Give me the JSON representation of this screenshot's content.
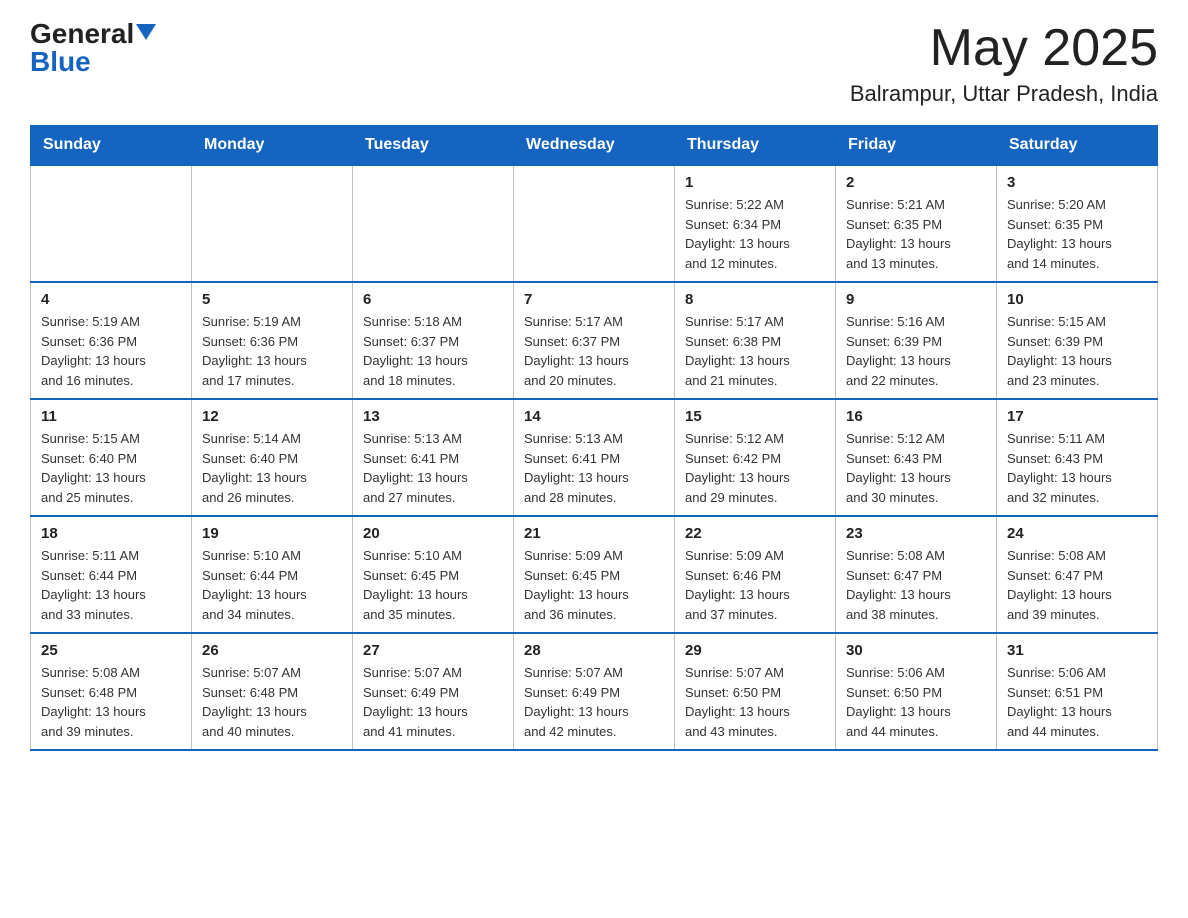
{
  "header": {
    "logo_general": "General",
    "logo_blue": "Blue",
    "month_year": "May 2025",
    "location": "Balrampur, Uttar Pradesh, India"
  },
  "days_of_week": [
    "Sunday",
    "Monday",
    "Tuesday",
    "Wednesday",
    "Thursday",
    "Friday",
    "Saturday"
  ],
  "weeks": [
    [
      {
        "day": "",
        "info": ""
      },
      {
        "day": "",
        "info": ""
      },
      {
        "day": "",
        "info": ""
      },
      {
        "day": "",
        "info": ""
      },
      {
        "day": "1",
        "info": "Sunrise: 5:22 AM\nSunset: 6:34 PM\nDaylight: 13 hours\nand 12 minutes."
      },
      {
        "day": "2",
        "info": "Sunrise: 5:21 AM\nSunset: 6:35 PM\nDaylight: 13 hours\nand 13 minutes."
      },
      {
        "day": "3",
        "info": "Sunrise: 5:20 AM\nSunset: 6:35 PM\nDaylight: 13 hours\nand 14 minutes."
      }
    ],
    [
      {
        "day": "4",
        "info": "Sunrise: 5:19 AM\nSunset: 6:36 PM\nDaylight: 13 hours\nand 16 minutes."
      },
      {
        "day": "5",
        "info": "Sunrise: 5:19 AM\nSunset: 6:36 PM\nDaylight: 13 hours\nand 17 minutes."
      },
      {
        "day": "6",
        "info": "Sunrise: 5:18 AM\nSunset: 6:37 PM\nDaylight: 13 hours\nand 18 minutes."
      },
      {
        "day": "7",
        "info": "Sunrise: 5:17 AM\nSunset: 6:37 PM\nDaylight: 13 hours\nand 20 minutes."
      },
      {
        "day": "8",
        "info": "Sunrise: 5:17 AM\nSunset: 6:38 PM\nDaylight: 13 hours\nand 21 minutes."
      },
      {
        "day": "9",
        "info": "Sunrise: 5:16 AM\nSunset: 6:39 PM\nDaylight: 13 hours\nand 22 minutes."
      },
      {
        "day": "10",
        "info": "Sunrise: 5:15 AM\nSunset: 6:39 PM\nDaylight: 13 hours\nand 23 minutes."
      }
    ],
    [
      {
        "day": "11",
        "info": "Sunrise: 5:15 AM\nSunset: 6:40 PM\nDaylight: 13 hours\nand 25 minutes."
      },
      {
        "day": "12",
        "info": "Sunrise: 5:14 AM\nSunset: 6:40 PM\nDaylight: 13 hours\nand 26 minutes."
      },
      {
        "day": "13",
        "info": "Sunrise: 5:13 AM\nSunset: 6:41 PM\nDaylight: 13 hours\nand 27 minutes."
      },
      {
        "day": "14",
        "info": "Sunrise: 5:13 AM\nSunset: 6:41 PM\nDaylight: 13 hours\nand 28 minutes."
      },
      {
        "day": "15",
        "info": "Sunrise: 5:12 AM\nSunset: 6:42 PM\nDaylight: 13 hours\nand 29 minutes."
      },
      {
        "day": "16",
        "info": "Sunrise: 5:12 AM\nSunset: 6:43 PM\nDaylight: 13 hours\nand 30 minutes."
      },
      {
        "day": "17",
        "info": "Sunrise: 5:11 AM\nSunset: 6:43 PM\nDaylight: 13 hours\nand 32 minutes."
      }
    ],
    [
      {
        "day": "18",
        "info": "Sunrise: 5:11 AM\nSunset: 6:44 PM\nDaylight: 13 hours\nand 33 minutes."
      },
      {
        "day": "19",
        "info": "Sunrise: 5:10 AM\nSunset: 6:44 PM\nDaylight: 13 hours\nand 34 minutes."
      },
      {
        "day": "20",
        "info": "Sunrise: 5:10 AM\nSunset: 6:45 PM\nDaylight: 13 hours\nand 35 minutes."
      },
      {
        "day": "21",
        "info": "Sunrise: 5:09 AM\nSunset: 6:45 PM\nDaylight: 13 hours\nand 36 minutes."
      },
      {
        "day": "22",
        "info": "Sunrise: 5:09 AM\nSunset: 6:46 PM\nDaylight: 13 hours\nand 37 minutes."
      },
      {
        "day": "23",
        "info": "Sunrise: 5:08 AM\nSunset: 6:47 PM\nDaylight: 13 hours\nand 38 minutes."
      },
      {
        "day": "24",
        "info": "Sunrise: 5:08 AM\nSunset: 6:47 PM\nDaylight: 13 hours\nand 39 minutes."
      }
    ],
    [
      {
        "day": "25",
        "info": "Sunrise: 5:08 AM\nSunset: 6:48 PM\nDaylight: 13 hours\nand 39 minutes."
      },
      {
        "day": "26",
        "info": "Sunrise: 5:07 AM\nSunset: 6:48 PM\nDaylight: 13 hours\nand 40 minutes."
      },
      {
        "day": "27",
        "info": "Sunrise: 5:07 AM\nSunset: 6:49 PM\nDaylight: 13 hours\nand 41 minutes."
      },
      {
        "day": "28",
        "info": "Sunrise: 5:07 AM\nSunset: 6:49 PM\nDaylight: 13 hours\nand 42 minutes."
      },
      {
        "day": "29",
        "info": "Sunrise: 5:07 AM\nSunset: 6:50 PM\nDaylight: 13 hours\nand 43 minutes."
      },
      {
        "day": "30",
        "info": "Sunrise: 5:06 AM\nSunset: 6:50 PM\nDaylight: 13 hours\nand 44 minutes."
      },
      {
        "day": "31",
        "info": "Sunrise: 5:06 AM\nSunset: 6:51 PM\nDaylight: 13 hours\nand 44 minutes."
      }
    ]
  ]
}
